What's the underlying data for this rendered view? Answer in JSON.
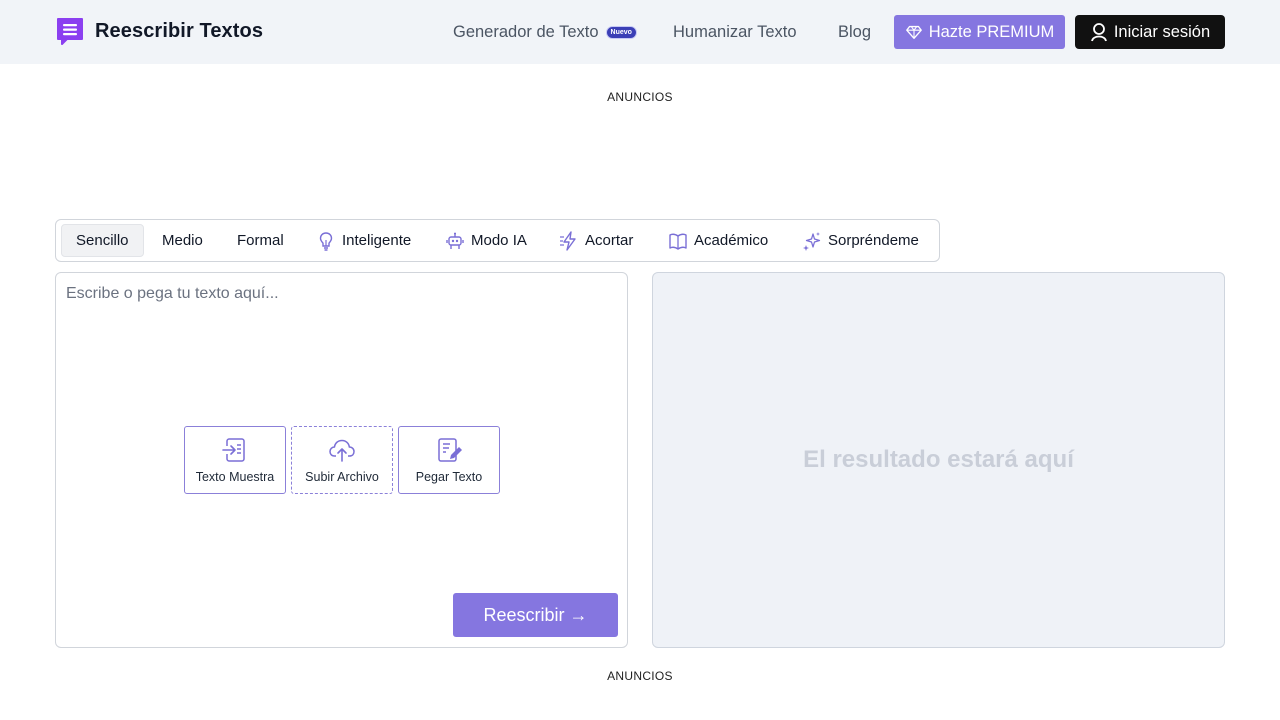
{
  "header": {
    "brand": "Reescribir Textos",
    "nav": {
      "generator": "Generador de Texto",
      "generator_badge": "Nuevo",
      "humanize": "Humanizar Texto",
      "blog": "Blog"
    },
    "premium_button": "Hazte PREMIUM",
    "login_button": "Iniciar sesión"
  },
  "ads": {
    "top": "ANUNCIOS",
    "bottom": "ANUNCIOS"
  },
  "modes": [
    {
      "label": "Sencillo",
      "icon": "",
      "active": true
    },
    {
      "label": "Medio",
      "icon": "",
      "active": false
    },
    {
      "label": "Formal",
      "icon": "",
      "active": false
    },
    {
      "label": "Inteligente",
      "icon": "lightbulb-icon",
      "active": false
    },
    {
      "label": "Modo IA",
      "icon": "robot-icon",
      "active": false
    },
    {
      "label": "Acortar",
      "icon": "lightning-icon",
      "active": false
    },
    {
      "label": "Académico",
      "icon": "book-icon",
      "active": false
    },
    {
      "label": "Sorpréndeme",
      "icon": "sparkles-icon",
      "active": false
    }
  ],
  "input": {
    "placeholder": "Escribe o pega tu texto aquí...",
    "value": "",
    "actions": {
      "sample": "Texto Muestra",
      "upload": "Subir Archivo",
      "paste": "Pegar Texto"
    },
    "rewrite_button": "Reescribir →"
  },
  "output": {
    "placeholder": "El resultado estará aquí"
  },
  "colors": {
    "accent": "#8576e0",
    "header_bg": "#f1f4f8",
    "output_bg": "#eff2f7",
    "login_bg": "#111111",
    "logo": "#8b3ff0"
  }
}
